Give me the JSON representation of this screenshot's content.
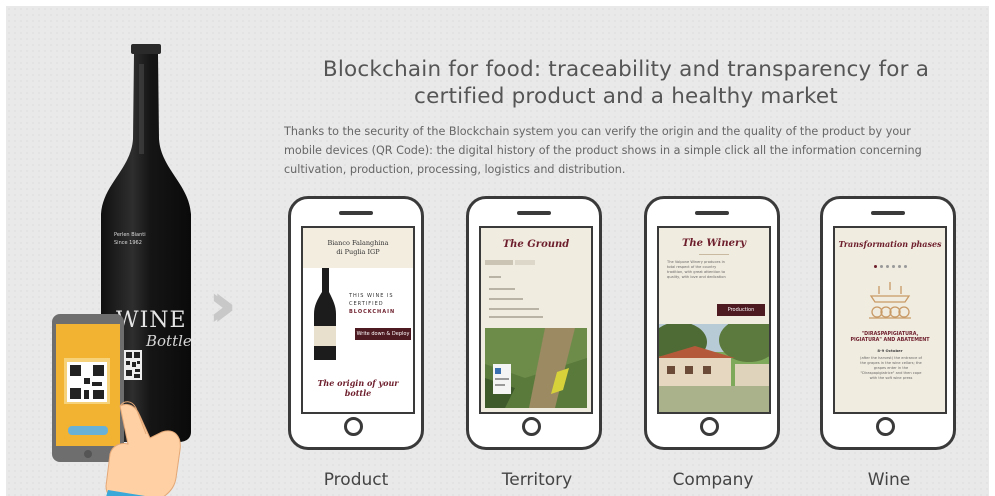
{
  "headline": {
    "line1": "Blockchain for food: traceability and transparency for a",
    "line2": "certified product and a healthy market"
  },
  "intro": {
    "line1": "Thanks to the security of the Blockchain system you can verify the origin and the quality of the product by your",
    "line2": "mobile devices (QR Code): the digital history of the product shows in a simple click all the information concerning",
    "line3": "cultivation, production, processing, logistics and distribution."
  },
  "bottle": {
    "label_top": "Perlen Bianti",
    "label_year": "Since 1962",
    "word1": "WINE",
    "word2": "Bottle"
  },
  "arrow_icon": "double-chevron-right-icon",
  "phones": [
    {
      "label": "Product",
      "screen": {
        "header_line1": "Bianco Falanghina",
        "header_line2": "di Puglia IGP",
        "cert_line1": "THIS WINE IS",
        "cert_line2": "CERTIFIED",
        "cert_line3": "BLOCKCHAIN",
        "button": "Write down & Deploy",
        "footer_line1": "The origin of your",
        "footer_line2": "bottle"
      }
    },
    {
      "label": "Territory",
      "screen": {
        "title": "The Ground"
      }
    },
    {
      "label": "Company",
      "screen": {
        "title": "The Winery",
        "text_line1": "The Volpone Winery produces in",
        "text_line2": "total respect of the country",
        "text_line3": "tradition, with great attention to",
        "text_line4": "quality, with love and dedication",
        "button": "Production"
      }
    },
    {
      "label": "Wine",
      "screen": {
        "title": "Transformation phases",
        "step_title_line1": "\"DIRASPAPIGIATURA,",
        "step_title_line2": "PIGIATURA\" AND ABATEMENT",
        "step_date": "8-9 October",
        "step_text_line1": "(after the harvest) the entrance of",
        "step_text_line2": "the grapes in the wine cellars; the",
        "step_text_line3": "grapes enter in the",
        "step_text_line4": "\"Diraspapigiatrice\" and then cope",
        "step_text_line5": "with the soft wine press"
      }
    }
  ],
  "colors": {
    "background": "#e9e9e9",
    "wine_red": "#6d1e2c",
    "phone_outline": "#3a3a3a",
    "scanner_yellow": "#f2b332"
  }
}
